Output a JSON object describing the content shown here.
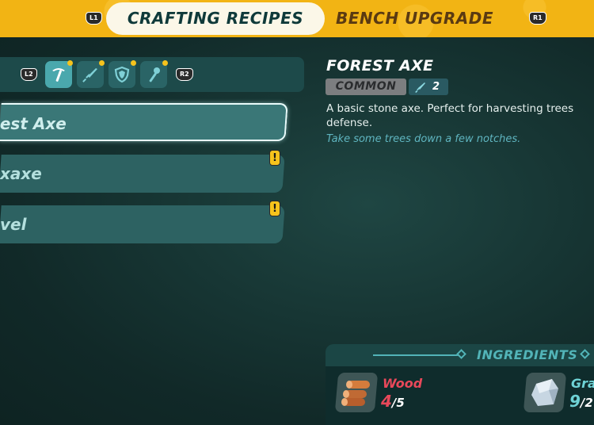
{
  "header": {
    "left_button": "L1",
    "right_button": "R1",
    "tabs": [
      {
        "label": "CRAFTING RECIPES",
        "active": true
      },
      {
        "label": "BENCH UPGRADE",
        "active": false
      }
    ]
  },
  "filters": {
    "left_button": "L2",
    "right_button": "R2",
    "categories": [
      {
        "icon": "pickaxe-icon",
        "active": true,
        "has_alert_dot": true
      },
      {
        "icon": "sword-icon",
        "active": false,
        "has_alert_dot": true
      },
      {
        "icon": "shield-icon",
        "active": false,
        "has_alert_dot": true
      },
      {
        "icon": "torch-icon",
        "active": false,
        "has_alert_dot": true
      }
    ]
  },
  "recipes": [
    {
      "label": "est Axe",
      "selected": true,
      "alert": false
    },
    {
      "label": "xaxe",
      "selected": false,
      "alert": true,
      "alert_symbol": "!"
    },
    {
      "label": "vel",
      "selected": false,
      "alert": true,
      "alert_symbol": "!"
    }
  ],
  "item": {
    "title": "FOREST AXE",
    "rarity": "COMMON",
    "power": "2",
    "description_line1": "A basic stone axe. Perfect for harvesting trees",
    "description_line2": "defense.",
    "flavor": "Take some trees down a few notches."
  },
  "ingredients": {
    "title": "INGREDIENTS",
    "items": [
      {
        "name": "Wood",
        "have": "4",
        "sep": "/",
        "need": "5",
        "name_color": "#e8485a",
        "have_color": "#e8485a",
        "icon": "wood-logs-icon"
      },
      {
        "name": "Gra",
        "have": "9",
        "sep": "/",
        "need": "2",
        "name_color": "#6fd3d6",
        "have_color": "#6fd3d6",
        "icon": "granite-icon"
      }
    ]
  }
}
